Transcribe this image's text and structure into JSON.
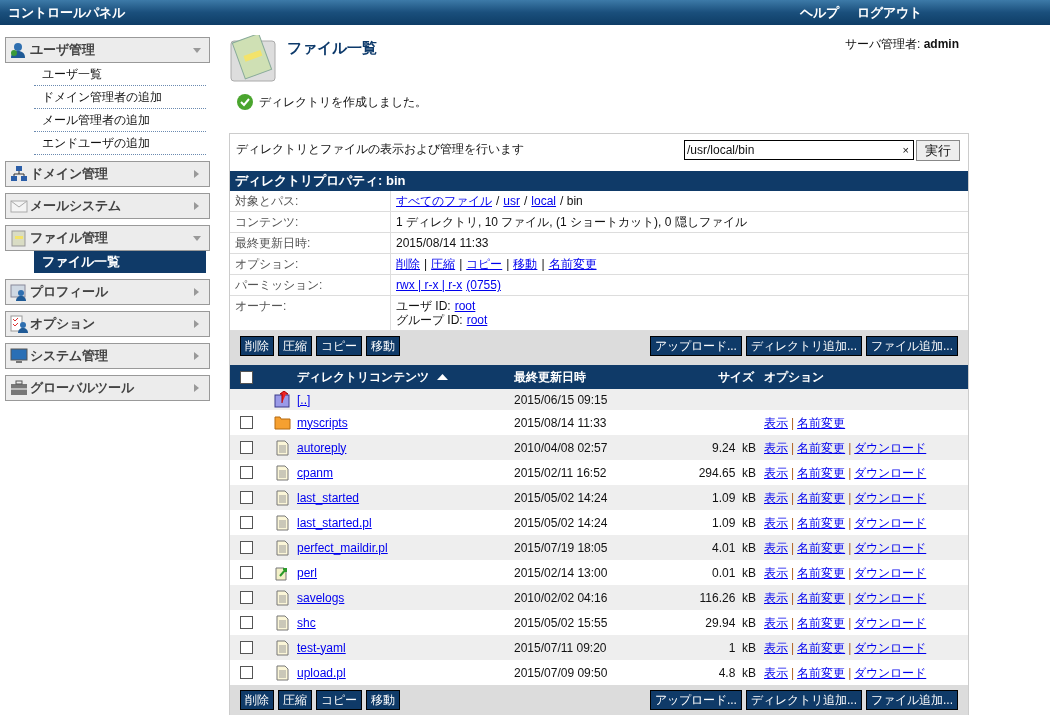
{
  "topbar": {
    "title": "コントロールパネル",
    "links": [
      "ヘルプ",
      "ログアウト"
    ]
  },
  "sidebar": {
    "sections": [
      {
        "kind": "user",
        "label": "ユーザ管理",
        "expanded": true,
        "items": [
          {
            "label": "ユーザ一覧",
            "selected": false
          },
          {
            "label": "ドメイン管理者の追加",
            "selected": false
          },
          {
            "label": "メール管理者の追加",
            "selected": false
          },
          {
            "label": "エンドユーザの追加",
            "selected": false
          }
        ]
      },
      {
        "kind": "network",
        "label": "ドメイン管理",
        "expanded": false
      },
      {
        "kind": "mail",
        "label": "メールシステム",
        "expanded": false
      },
      {
        "kind": "files",
        "label": "ファイル管理",
        "expanded": true,
        "items": [
          {
            "label": "ファイル一覧",
            "selected": true
          }
        ]
      },
      {
        "kind": "profile",
        "label": "プロフィール",
        "expanded": false
      },
      {
        "kind": "options",
        "label": "オプション",
        "expanded": false
      },
      {
        "kind": "system",
        "label": "システム管理",
        "expanded": false
      },
      {
        "kind": "tools",
        "label": "グローバルツール",
        "expanded": false
      }
    ]
  },
  "page": {
    "title": "ファイル一覧",
    "user": "サーバ管理者: **admin**",
    "message": "ディレクトリを作成しました。"
  },
  "panel": {
    "description": "ディレクトリとファイルの表示および管理を行います",
    "path_field": {
      "value": "/usr/local/bin",
      "clear": "×"
    },
    "go_button": "実行",
    "properties_title": "ディレクトリプロパティ: bin",
    "properties": [
      {
        "label": "対象とパス:",
        "lines": [
          [
            {
              "text": "すべてのファイル",
              "kind": "link"
            },
            {
              "text": "/",
              "kind": "text"
            },
            {
              "text": "usr",
              "kind": "link"
            },
            {
              "text": "/",
              "kind": "text"
            },
            {
              "text": "local",
              "kind": "link"
            },
            {
              "text": "/ bin",
              "kind": "text"
            }
          ]
        ]
      },
      {
        "label": "コンテンツ:",
        "lines": [
          [
            {
              "text": "1 ディレクトリ, 10 ファイル, (1 ショートカット), 0 隠しファイル",
              "kind": "text"
            }
          ]
        ]
      },
      {
        "label": "最終更新日時:",
        "lines": [
          [
            {
              "text": "2015/08/14 11:33",
              "kind": "text"
            }
          ]
        ]
      },
      {
        "label": "オプション:",
        "lines": [
          [
            {
              "text": "削除",
              "kind": "link"
            },
            {
              "text": "|",
              "kind": "text"
            },
            {
              "text": "圧縮",
              "kind": "link"
            },
            {
              "text": "|",
              "kind": "text"
            },
            {
              "text": "コピー",
              "kind": "link"
            },
            {
              "text": "|",
              "kind": "text"
            },
            {
              "text": "移動",
              "kind": "link"
            },
            {
              "text": "|",
              "kind": "text"
            },
            {
              "text": "名前変更",
              "kind": "link"
            }
          ]
        ]
      },
      {
        "label": "パーミッション:",
        "lines": [
          [
            {
              "text": "rwx | r-x | r-x",
              "kind": "link"
            },
            {
              "text": "(0755)",
              "kind": "link"
            }
          ]
        ]
      },
      {
        "label": "オーナー:",
        "lines": [
          [
            {
              "text": "ユーザ ID:",
              "kind": "text"
            },
            {
              "text": "root",
              "kind": "link"
            }
          ],
          [
            {
              "text": "グループ ID:",
              "kind": "text"
            },
            {
              "text": "root",
              "kind": "link"
            }
          ]
        ]
      }
    ],
    "top_actions": {
      "left": [
        "削除",
        "圧縮",
        "コピー",
        "移動"
      ],
      "right": [
        "アップロード...",
        "ディレクトリ追加...",
        "ファイル追加..."
      ]
    },
    "table": {
      "select_all": {
        "checked": false
      },
      "columns": [
        {
          "label": "ディレクトリコンテンツ",
          "sort_ascending": true
        },
        {
          "label": "最終更新日時"
        },
        {
          "label": "サイズ"
        },
        {
          "label": "オプション"
        }
      ],
      "rows": [
        {
          "kind": "parent",
          "name": "[..]",
          "date": "2015/06/15 09:15"
        },
        {
          "kind": "folder",
          "checked": false,
          "name": "myscripts",
          "date": "2015/08/14 11:33",
          "options": [
            {
              "kind": "link",
              "text": "表示"
            },
            {
              "kind": "sep",
              "text": "|"
            },
            {
              "kind": "link",
              "text": "名前変更"
            }
          ]
        },
        {
          "kind": "file",
          "checked": false,
          "name": "autoreply",
          "date": "2010/04/08 02:57",
          "size": "9.24  kB",
          "options": [
            {
              "kind": "link",
              "text": "表示"
            },
            {
              "kind": "sep",
              "text": "|"
            },
            {
              "kind": "link",
              "text": "名前変更"
            },
            {
              "kind": "sep",
              "text": "|"
            },
            {
              "kind": "link",
              "text": "ダウンロード"
            }
          ]
        },
        {
          "kind": "file",
          "checked": false,
          "name": "cpanm",
          "date": "2015/02/11 16:52",
          "size": "294.65  kB",
          "options": [
            {
              "kind": "link",
              "text": "表示"
            },
            {
              "kind": "sep",
              "text": "|"
            },
            {
              "kind": "link",
              "text": "名前変更"
            },
            {
              "kind": "sep",
              "text": "|"
            },
            {
              "kind": "link",
              "text": "ダウンロード"
            }
          ]
        },
        {
          "kind": "file",
          "checked": false,
          "name": "last_started",
          "date": "2015/05/02 14:24",
          "size": "1.09  kB",
          "options": [
            {
              "kind": "link",
              "text": "表示"
            },
            {
              "kind": "sep",
              "text": "|"
            },
            {
              "kind": "link",
              "text": "名前変更"
            },
            {
              "kind": "sep",
              "text": "|"
            },
            {
              "kind": "link",
              "text": "ダウンロード"
            }
          ]
        },
        {
          "kind": "file",
          "checked": false,
          "name": "last_started.pl",
          "date": "2015/05/02 14:24",
          "size": "1.09  kB",
          "options": [
            {
              "kind": "link",
              "text": "表示"
            },
            {
              "kind": "sep",
              "text": "|"
            },
            {
              "kind": "link",
              "text": "名前変更"
            },
            {
              "kind": "sep",
              "text": "|"
            },
            {
              "kind": "link",
              "text": "ダウンロード"
            }
          ]
        },
        {
          "kind": "file",
          "checked": false,
          "name": "perfect_maildir.pl",
          "date": "2015/07/19 18:05",
          "size": "4.01  kB",
          "options": [
            {
              "kind": "link",
              "text": "表示"
            },
            {
              "kind": "sep",
              "text": "|"
            },
            {
              "kind": "link",
              "text": "名前変更"
            },
            {
              "kind": "sep",
              "text": "|"
            },
            {
              "kind": "link",
              "text": "ダウンロード"
            }
          ]
        },
        {
          "kind": "link",
          "checked": false,
          "name": "perl",
          "date": "2015/02/14 13:00",
          "size": "0.01  kB",
          "options": [
            {
              "kind": "link",
              "text": "表示"
            },
            {
              "kind": "sep",
              "text": "|"
            },
            {
              "kind": "link",
              "text": "名前変更"
            },
            {
              "kind": "sep",
              "text": "|"
            },
            {
              "kind": "link",
              "text": "ダウンロード"
            }
          ]
        },
        {
          "kind": "file",
          "checked": false,
          "name": "savelogs",
          "date": "2010/02/02 04:16",
          "size": "116.26  kB",
          "options": [
            {
              "kind": "link",
              "text": "表示"
            },
            {
              "kind": "sep",
              "text": "|"
            },
            {
              "kind": "link",
              "text": "名前変更"
            },
            {
              "kind": "sep",
              "text": "|"
            },
            {
              "kind": "link",
              "text": "ダウンロード"
            }
          ]
        },
        {
          "kind": "file",
          "checked": false,
          "name": "shc",
          "date": "2015/05/02 15:55",
          "size": "29.94  kB",
          "options": [
            {
              "kind": "link",
              "text": "表示"
            },
            {
              "kind": "sep",
              "text": "|"
            },
            {
              "kind": "link",
              "text": "名前変更"
            },
            {
              "kind": "sep",
              "text": "|"
            },
            {
              "kind": "link",
              "text": "ダウンロード"
            }
          ]
        },
        {
          "kind": "file",
          "checked": false,
          "name": "test-yaml",
          "date": "2015/07/11 09:20",
          "size": "1  kB",
          "options": [
            {
              "kind": "link",
              "text": "表示"
            },
            {
              "kind": "sep",
              "text": "|"
            },
            {
              "kind": "link",
              "text": "名前変更"
            },
            {
              "kind": "sep",
              "text": "|"
            },
            {
              "kind": "link",
              "text": "ダウンロード"
            }
          ]
        },
        {
          "kind": "file",
          "checked": false,
          "name": "upload.pl",
          "date": "2015/07/09 09:50",
          "size": "4.8  kB",
          "options": [
            {
              "kind": "link",
              "text": "表示"
            },
            {
              "kind": "sep",
              "text": "|"
            },
            {
              "kind": "link",
              "text": "名前変更"
            },
            {
              "kind": "sep",
              "text": "|"
            },
            {
              "kind": "link",
              "text": "ダウンロード"
            }
          ]
        }
      ]
    },
    "bottom_actions": {
      "left": [
        "削除",
        "圧縮",
        "コピー",
        "移動"
      ],
      "right": [
        "アップロード...",
        "ディレクトリ追加...",
        "ファイル追加..."
      ]
    }
  }
}
